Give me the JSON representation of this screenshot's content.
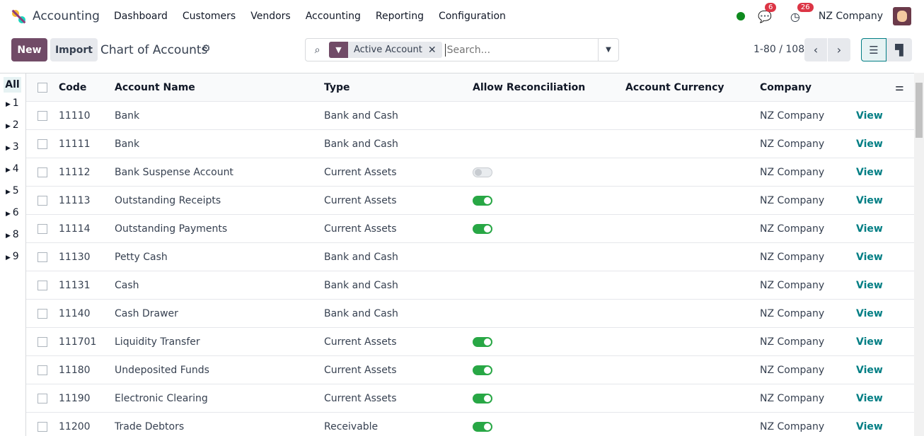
{
  "nav": {
    "app": "Accounting",
    "menu": [
      "Dashboard",
      "Customers",
      "Vendors",
      "Accounting",
      "Reporting",
      "Configuration"
    ],
    "messages_count": "6",
    "activities_count": "26",
    "company": "NZ Company"
  },
  "control": {
    "new": "New",
    "import": "Import",
    "title": "Chart of Accounts",
    "facet": "Active Account",
    "search_placeholder": "Search...",
    "pager": "1-80 / 108"
  },
  "sidebar": [
    "All",
    "1",
    "2",
    "3",
    "4",
    "5",
    "6",
    "8",
    "9"
  ],
  "columns": [
    "Code",
    "Account Name",
    "Type",
    "Allow Reconciliation",
    "Account Currency",
    "Company"
  ],
  "view_label": "View",
  "rows": [
    {
      "code": "11110",
      "name": "Bank",
      "type": "Bank and Cash",
      "reconcile": null,
      "currency": "",
      "company": "NZ Company"
    },
    {
      "code": "11111",
      "name": "Bank",
      "type": "Bank and Cash",
      "reconcile": null,
      "currency": "",
      "company": "NZ Company"
    },
    {
      "code": "11112",
      "name": "Bank Suspense Account",
      "type": "Current Assets",
      "reconcile": false,
      "currency": "",
      "company": "NZ Company"
    },
    {
      "code": "11113",
      "name": "Outstanding Receipts",
      "type": "Current Assets",
      "reconcile": true,
      "currency": "",
      "company": "NZ Company"
    },
    {
      "code": "11114",
      "name": "Outstanding Payments",
      "type": "Current Assets",
      "reconcile": true,
      "currency": "",
      "company": "NZ Company"
    },
    {
      "code": "11130",
      "name": "Petty Cash",
      "type": "Bank and Cash",
      "reconcile": null,
      "currency": "",
      "company": "NZ Company"
    },
    {
      "code": "11131",
      "name": "Cash",
      "type": "Bank and Cash",
      "reconcile": null,
      "currency": "",
      "company": "NZ Company"
    },
    {
      "code": "11140",
      "name": "Cash Drawer",
      "type": "Bank and Cash",
      "reconcile": null,
      "currency": "",
      "company": "NZ Company"
    },
    {
      "code": "111701",
      "name": "Liquidity Transfer",
      "type": "Current Assets",
      "reconcile": true,
      "currency": "",
      "company": "NZ Company"
    },
    {
      "code": "11180",
      "name": "Undeposited Funds",
      "type": "Current Assets",
      "reconcile": true,
      "currency": "",
      "company": "NZ Company"
    },
    {
      "code": "11190",
      "name": "Electronic Clearing",
      "type": "Current Assets",
      "reconcile": true,
      "currency": "",
      "company": "NZ Company"
    },
    {
      "code": "11200",
      "name": "Trade Debtors",
      "type": "Receivable",
      "reconcile": true,
      "currency": "",
      "company": "NZ Company"
    }
  ]
}
